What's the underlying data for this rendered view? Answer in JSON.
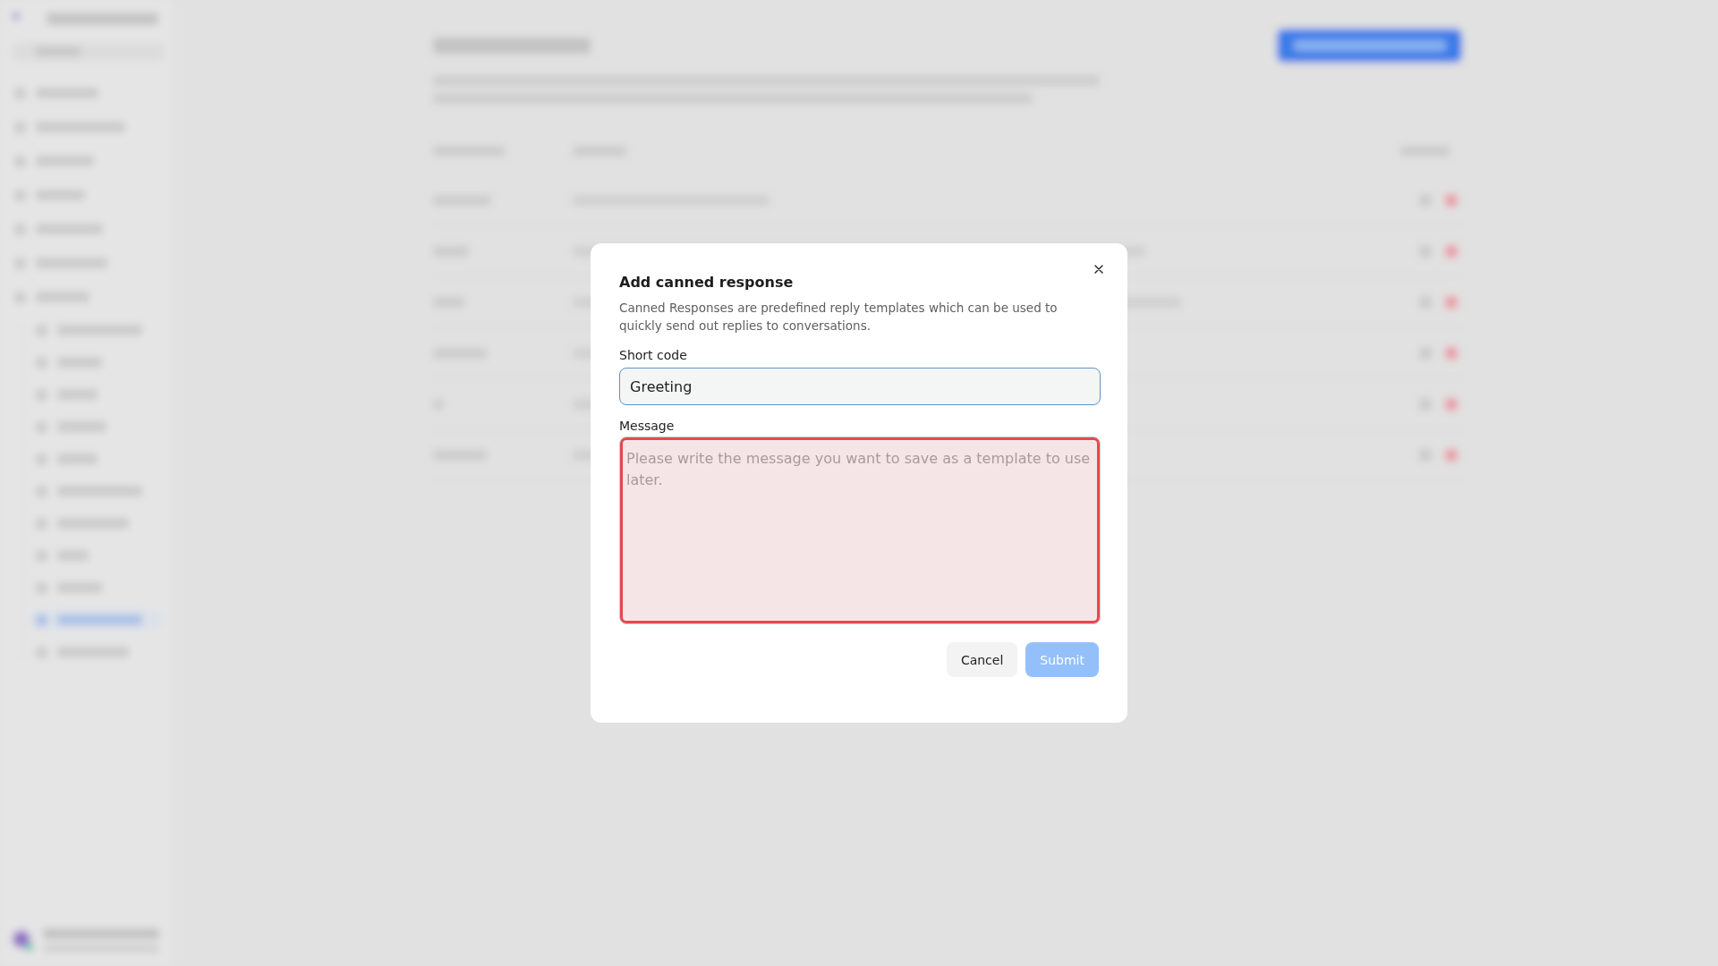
{
  "modal": {
    "title": "Add canned response",
    "description": "Canned Responses are predefined reply templates which can be used to quickly send out replies to conversations.",
    "fields": [
      {
        "kind": "input",
        "label": "Short code",
        "value": "Greeting",
        "focused": true,
        "error": false
      },
      {
        "kind": "textarea",
        "label": "Message",
        "placeholder": "Please write the message you want to save as a template to use later.",
        "focused": false,
        "error": true
      }
    ],
    "buttons": [
      {
        "label": "Cancel",
        "kind": "secondary",
        "disabled": false
      },
      {
        "label": "Submit",
        "kind": "primary",
        "disabled": true
      }
    ]
  }
}
